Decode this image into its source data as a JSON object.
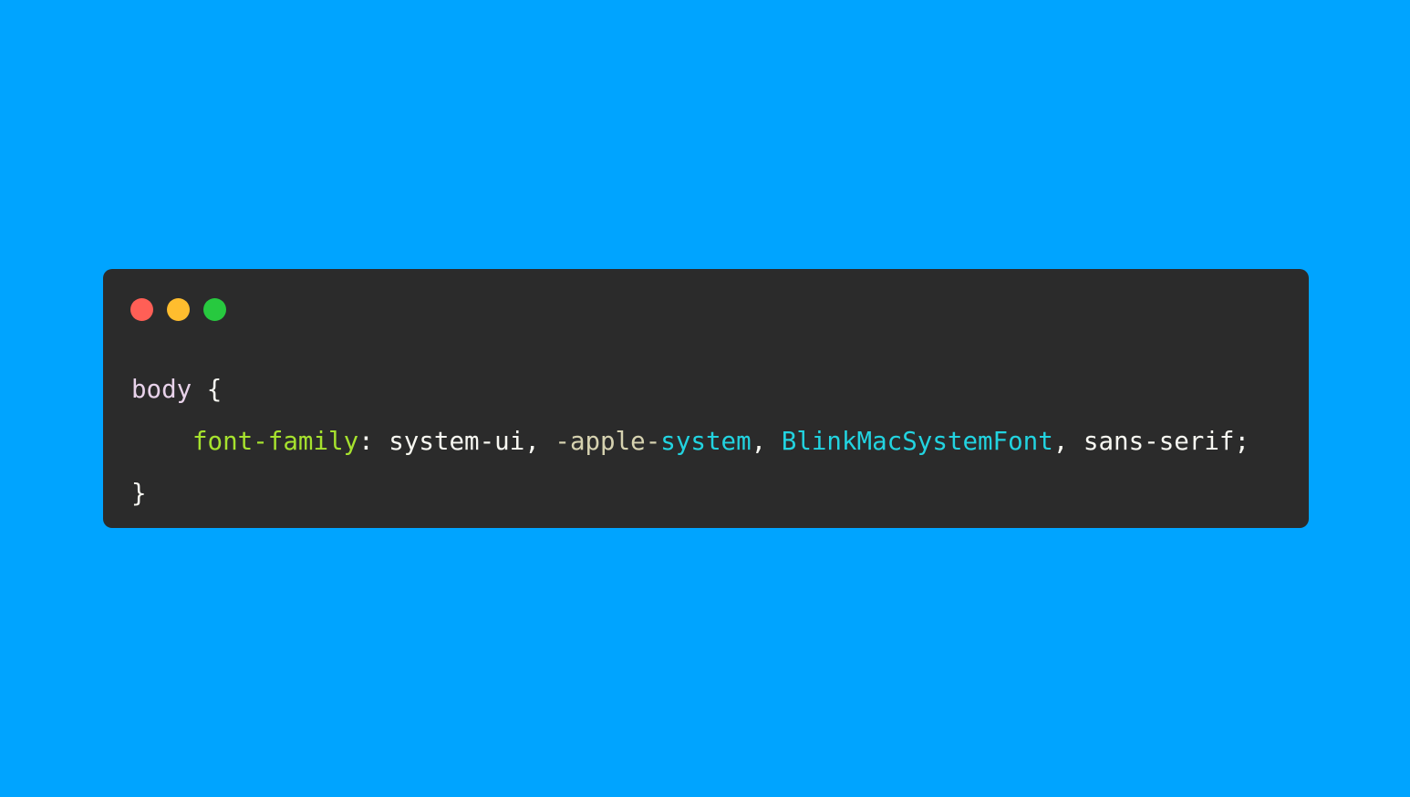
{
  "colors": {
    "background": "#00a4ff",
    "window": "#2b2b2b",
    "dot_red": "#ff5f56",
    "dot_yellow": "#ffbd2e",
    "dot_green": "#27c93f",
    "selector": "#e8d2ea",
    "property": "#a6e22e",
    "plain": "#f8f8f2",
    "muted_prefix": "#d6d2b0",
    "cyan": "#22d3e0"
  },
  "window": {
    "controls": [
      "close-dot",
      "minimize-dot",
      "zoom-dot"
    ]
  },
  "code": {
    "line1": {
      "selector": "body",
      "open_brace": " {"
    },
    "line2": {
      "property": "font-family",
      "colon": ": ",
      "value1": "system-ui",
      "comma1": ", ",
      "value2_prefix": "-apple-",
      "value2_suffix": "system",
      "comma2": ", ",
      "value3": "BlinkMacSystemFont",
      "comma3": ", ",
      "value4": "sans-serif",
      "semicolon": ";"
    },
    "line3": {
      "close_brace": "}"
    }
  }
}
